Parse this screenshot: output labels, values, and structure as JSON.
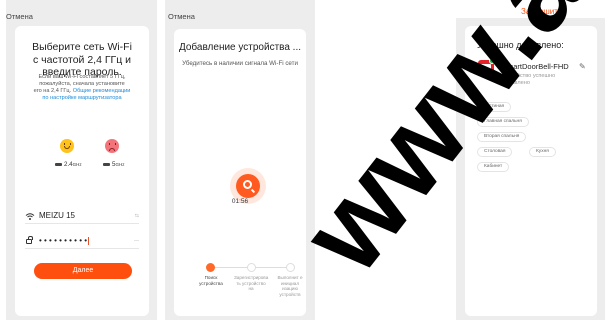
{
  "screen1": {
    "top_label": "Отмена",
    "title_line1": "Выберите сеть Wi-Fi",
    "title_line2": "с частотой 2,4 ГГц и",
    "title_line3": "введите пароль.",
    "subtitle_line1": "Если ваш Wi-Fi составляет 5 ГГц,",
    "subtitle_line2": "пожалуйста, сначала установите",
    "subtitle_line3_prefix": "его на 2,4 ГГц.",
    "subtitle_link_1": "Общие рекомендации",
    "subtitle_link_2": "по настройке маршрутизатора",
    "band_24_value": "2.4",
    "band_24_unit": "GHz",
    "band_5_value": "5",
    "band_5_unit": "GHz",
    "ssid_value": "MEIZU 15",
    "ssid_trailing": "⇆",
    "password_value": "• • • • • • • • • •",
    "password_trailing": "—",
    "next_button": "Далее"
  },
  "screen2": {
    "top_label": "Отмена",
    "title": "Добавление устройства ...",
    "subtitle": "Убедитесь в наличии сигнала Wi-Fi сети",
    "timer": "01:56",
    "step1_label": "Поиск устройства",
    "step2_label": "Зарегистрирова ть устройство на",
    "step3_label": "Выполнит е инициал изацию устройств"
  },
  "screen3": {
    "finish_link": "Завершить",
    "title": "Успешно добавлено:",
    "device_name": "SmartDoorBell-FHD",
    "device_status": "Устройство успешно добавлено",
    "rooms": [
      "Гостиная",
      "Главная спальня",
      "Вторая спальня",
      "Столовая",
      "Кухня",
      "Кабинет"
    ]
  },
  "watermark": {
    "text": "www.a"
  },
  "colors": {
    "accent": "#ff4f0f",
    "link": "#1e8bd6",
    "panel_bg": "#ededed",
    "success_badge": "#1fb85c",
    "device_red": "#e3222a"
  },
  "icons": [
    "happy-face-icon",
    "sad-face-icon",
    "router-icon",
    "wifi-icon",
    "lock-icon",
    "search-icon",
    "edit-icon",
    "doorbell-device-icon"
  ]
}
